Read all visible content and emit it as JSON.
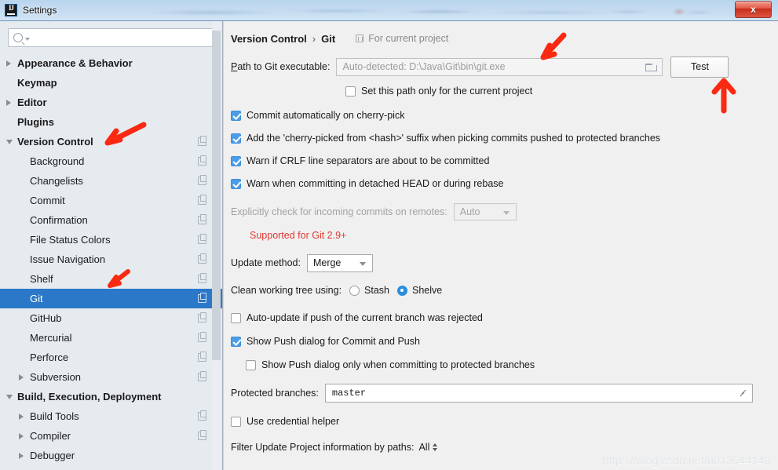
{
  "window": {
    "title": "Settings",
    "app_icon": "intellij-idea-icon",
    "close_label": "x"
  },
  "sidebar": {
    "search": {
      "value": "",
      "placeholder": "",
      "icon": "search-icon"
    },
    "items": [
      {
        "label": "Appearance & Behavior",
        "bold": true,
        "arrow": "collapsed",
        "indent": 0,
        "project_icon": false,
        "selected": false
      },
      {
        "label": "Keymap",
        "bold": true,
        "arrow": "none",
        "indent": 0,
        "project_icon": false,
        "selected": false
      },
      {
        "label": "Editor",
        "bold": true,
        "arrow": "collapsed",
        "indent": 0,
        "project_icon": false,
        "selected": false
      },
      {
        "label": "Plugins",
        "bold": true,
        "arrow": "none",
        "indent": 0,
        "project_icon": false,
        "selected": false
      },
      {
        "label": "Version Control",
        "bold": true,
        "arrow": "expanded",
        "indent": 0,
        "project_icon": true,
        "selected": false
      },
      {
        "label": "Background",
        "bold": false,
        "arrow": "none",
        "indent": 1,
        "project_icon": true,
        "selected": false
      },
      {
        "label": "Changelists",
        "bold": false,
        "arrow": "none",
        "indent": 1,
        "project_icon": true,
        "selected": false
      },
      {
        "label": "Commit",
        "bold": false,
        "arrow": "none",
        "indent": 1,
        "project_icon": true,
        "selected": false
      },
      {
        "label": "Confirmation",
        "bold": false,
        "arrow": "none",
        "indent": 1,
        "project_icon": true,
        "selected": false
      },
      {
        "label": "File Status Colors",
        "bold": false,
        "arrow": "none",
        "indent": 1,
        "project_icon": true,
        "selected": false
      },
      {
        "label": "Issue Navigation",
        "bold": false,
        "arrow": "none",
        "indent": 1,
        "project_icon": true,
        "selected": false
      },
      {
        "label": "Shelf",
        "bold": false,
        "arrow": "none",
        "indent": 1,
        "project_icon": true,
        "selected": false
      },
      {
        "label": "Git",
        "bold": false,
        "arrow": "none",
        "indent": 1,
        "project_icon": true,
        "selected": true
      },
      {
        "label": "GitHub",
        "bold": false,
        "arrow": "none",
        "indent": 1,
        "project_icon": true,
        "selected": false
      },
      {
        "label": "Mercurial",
        "bold": false,
        "arrow": "none",
        "indent": 1,
        "project_icon": true,
        "selected": false
      },
      {
        "label": "Perforce",
        "bold": false,
        "arrow": "none",
        "indent": 1,
        "project_icon": true,
        "selected": false
      },
      {
        "label": "Subversion",
        "bold": false,
        "arrow": "collapsed",
        "indent": 1,
        "project_icon": true,
        "selected": false
      },
      {
        "label": "Build, Execution, Deployment",
        "bold": true,
        "arrow": "expanded",
        "indent": 0,
        "project_icon": false,
        "selected": false
      },
      {
        "label": "Build Tools",
        "bold": false,
        "arrow": "collapsed",
        "indent": 1,
        "project_icon": true,
        "selected": false
      },
      {
        "label": "Compiler",
        "bold": false,
        "arrow": "collapsed",
        "indent": 1,
        "project_icon": true,
        "selected": false
      },
      {
        "label": "Debugger",
        "bold": false,
        "arrow": "collapsed",
        "indent": 1,
        "project_icon": false,
        "selected": false
      }
    ]
  },
  "panel": {
    "breadcrumb": {
      "parent": "Version Control",
      "separator": "›",
      "current": "Git"
    },
    "for_current_project": "For current project",
    "path": {
      "label_prefix": "P",
      "label_rest": "ath to Git executable:",
      "value": "",
      "placeholder": "Auto-detected: D:\\Java\\Git\\bin\\git.exe",
      "browse_icon": "folder-icon",
      "test_button": "Test"
    },
    "set_path_only": {
      "label": "Set this path only for the current project",
      "checked": false
    },
    "checkboxes": [
      {
        "label": "Commit automatically on cherry-pick",
        "checked": true
      },
      {
        "label": "Add the 'cherry-picked from <hash>' suffix when picking commits pushed to protected branches",
        "checked": true
      },
      {
        "label": "Warn if CRLF line separators are about to be committed",
        "checked": true
      },
      {
        "label": "Warn when committing in detached HEAD or during rebase",
        "checked": true
      }
    ],
    "incoming": {
      "label": "Explicitly check for incoming commits on remotes:",
      "value": "Auto",
      "disabled": true
    },
    "supported_note": "Supported for Git 2.9+",
    "update_method": {
      "label": "Update method:",
      "value": "Merge"
    },
    "clean_tree": {
      "label": "Clean working tree using:",
      "options": [
        "Stash",
        "Shelve"
      ],
      "selected": "Shelve"
    },
    "auto_update": {
      "label": "Auto-update if push of the current branch was rejected",
      "checked": false
    },
    "show_push": {
      "label": "Show Push dialog for Commit and Push",
      "checked": true
    },
    "show_push_protected": {
      "label": "Show Push dialog only when committing to protected branches",
      "checked": false
    },
    "protected_branches": {
      "label": "Protected branches:",
      "value": "master",
      "expand_icon": "expand-icon"
    },
    "credential_helper": {
      "label": "Use credential helper",
      "checked": false
    },
    "filter_paths": {
      "label": "Filter Update Project information by paths:",
      "value": "All"
    }
  },
  "annotations": {
    "color": "#FA2A12",
    "arrows": [
      "arrow-to-version-control",
      "arrow-to-shelf",
      "arrow-to-path-field",
      "arrow-to-test-button"
    ]
  },
  "watermark": "https://blog.csdn.net/u013644146"
}
